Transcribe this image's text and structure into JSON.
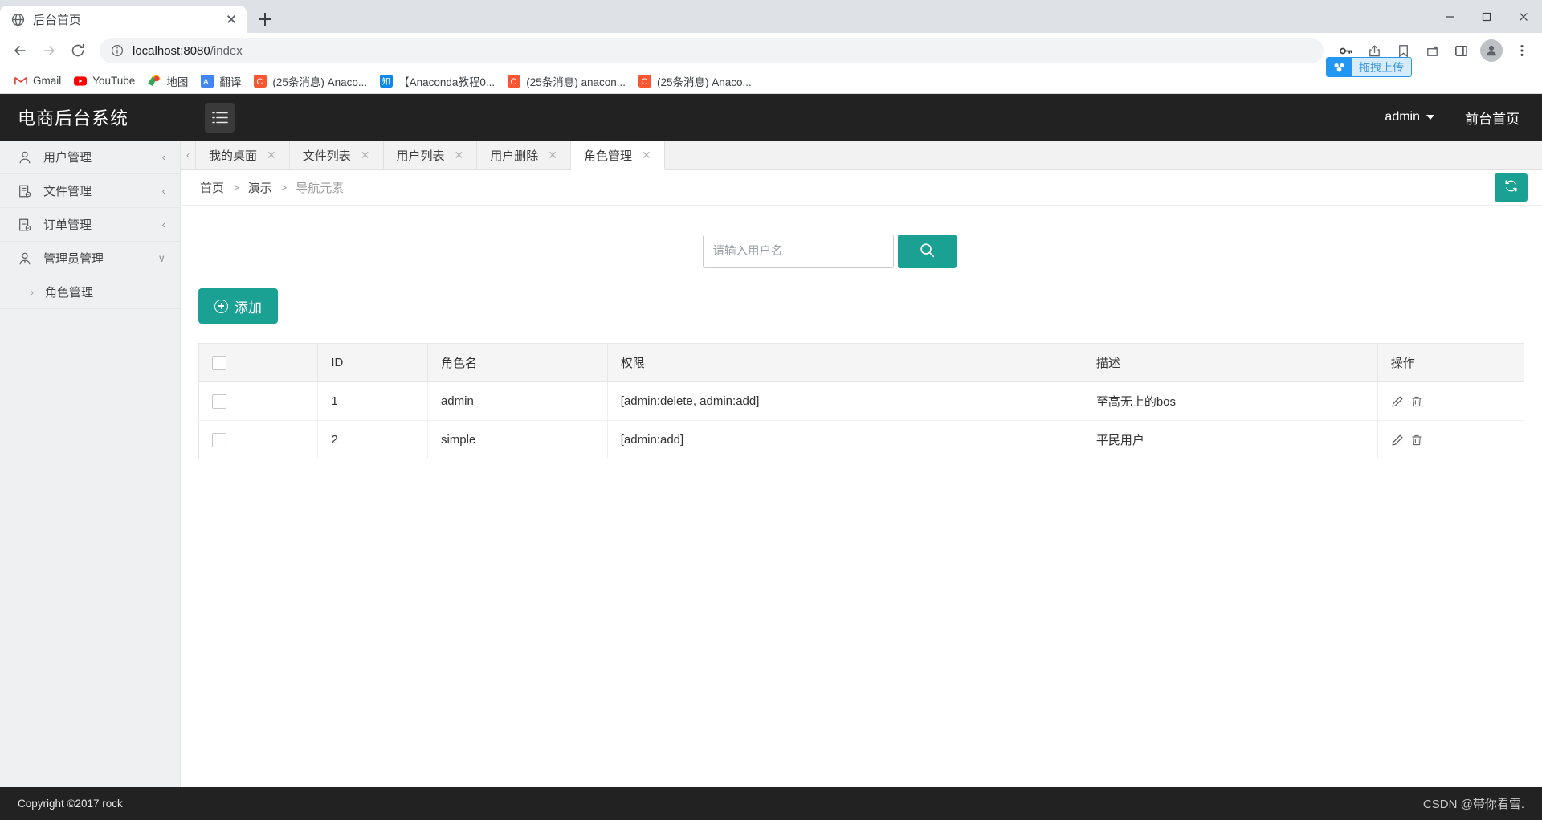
{
  "browser": {
    "tab": {
      "title": "后台首页",
      "favicon_icon": "globe-icon",
      "close_icon": "close-icon"
    },
    "new_tab_icon": "plus-icon",
    "window_controls": {
      "minimize_icon": "minimize-icon",
      "maximize_icon": "maximize-icon",
      "close_icon": "window-close-icon"
    },
    "nav": {
      "back_icon": "arrow-left-icon",
      "forward_icon": "arrow-right-icon",
      "reload_icon": "reload-icon",
      "info_icon": "info-circle-icon",
      "url_host": "localhost:8080",
      "url_path": "/index"
    },
    "toolbar_right": {
      "key_icon": "key-icon",
      "share_icon": "share-icon",
      "bookmark_icon": "bookmark-star-icon",
      "extensions_icon": "extensions-icon",
      "sidepanel_icon": "side-panel-icon",
      "profile_icon": "profile-avatar-icon",
      "menu_icon": "three-dot-menu-icon"
    },
    "upload_pill": {
      "label": "拖拽上传",
      "icon": "baidu-netdisk-icon",
      "accent": "#2196f3"
    },
    "bookmarks": [
      {
        "label": "Gmail",
        "icon": "gmail-icon"
      },
      {
        "label": "YouTube",
        "icon": "youtube-icon"
      },
      {
        "label": "地图",
        "icon": "google-maps-icon"
      },
      {
        "label": "翻译",
        "icon": "google-translate-icon"
      },
      {
        "label": "(25条消息) Anaco...",
        "icon": "csdn-icon"
      },
      {
        "label": "【Anaconda教程0...",
        "icon": "zhihu-icon"
      },
      {
        "label": "(25条消息) anacon...",
        "icon": "csdn-icon"
      },
      {
        "label": "(25条消息) Anaco...",
        "icon": "csdn-icon"
      }
    ]
  },
  "app": {
    "brand": "电商后台系统",
    "hamburger_icon": "list-menu-icon",
    "user": "admin",
    "front_link": "前台首页",
    "accent": "#1ba094",
    "header_bg": "#222222"
  },
  "sidebar": {
    "items": [
      {
        "label": "用户管理",
        "icon": "user-icon",
        "arrow": "‹",
        "expanded": false
      },
      {
        "label": "文件管理",
        "icon": "file-icon",
        "arrow": "‹",
        "expanded": false
      },
      {
        "label": "订单管理",
        "icon": "order-icon",
        "arrow": "‹",
        "expanded": false
      },
      {
        "label": "管理员管理",
        "icon": "admin-user-icon",
        "arrow": "∨",
        "expanded": true
      }
    ],
    "submenu": [
      {
        "label": "角色管理",
        "arrow": "›"
      }
    ]
  },
  "tabs": [
    {
      "label": "我的桌面",
      "active": false
    },
    {
      "label": "文件列表",
      "active": false
    },
    {
      "label": "用户列表",
      "active": false
    },
    {
      "label": "用户删除",
      "active": false
    },
    {
      "label": "角色管理",
      "active": true
    }
  ],
  "breadcrumb": {
    "items": [
      "首页",
      "演示",
      "导航元素"
    ],
    "separator": ">"
  },
  "refresh_button": {
    "icon": "refresh-icon"
  },
  "search": {
    "placeholder": "请输入用户名",
    "value": "",
    "button_icon": "search-icon"
  },
  "add_button": {
    "label": "添加",
    "icon": "plus-circle-icon"
  },
  "table": {
    "columns": [
      "",
      "ID",
      "角色名",
      "权限",
      "描述",
      "操作"
    ],
    "rows": [
      {
        "id": "1",
        "role": "admin",
        "perms": "[admin:delete, admin:add]",
        "desc": "至高无上的bos",
        "edit_icon": "pencil-icon",
        "delete_icon": "trash-icon"
      },
      {
        "id": "2",
        "role": "simple",
        "perms": "[admin:add]",
        "desc": "平民用户",
        "edit_icon": "pencil-icon",
        "delete_icon": "trash-icon"
      }
    ]
  },
  "footer": {
    "copyright": "Copyright ©2017 rock",
    "watermark": "CSDN @带你看雪."
  }
}
